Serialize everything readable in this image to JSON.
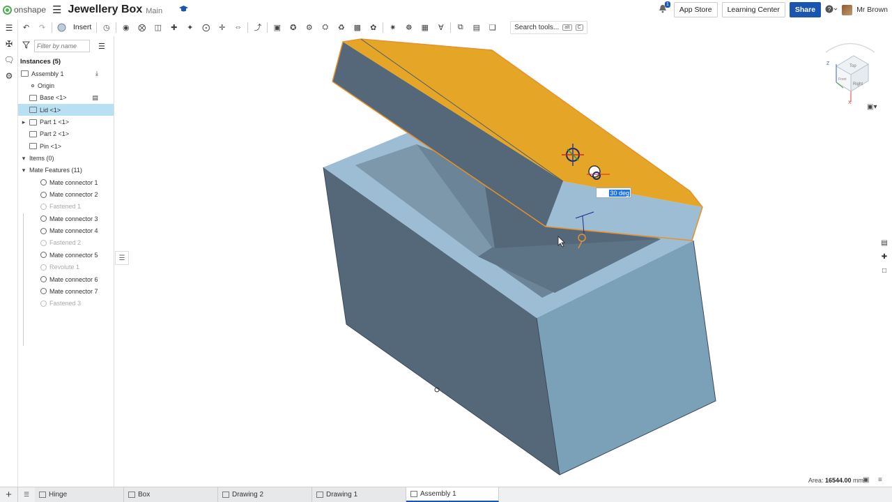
{
  "app": {
    "logo_text": "onshape",
    "doc_title": "Jewellery Box",
    "branch": "Main"
  },
  "topbar": {
    "notification_count": "1",
    "app_store": "App Store",
    "learning_center": "Learning Center",
    "share": "Share",
    "help": "?",
    "user_name": "Mr Brown"
  },
  "toolbar": {
    "insert_label": "Insert",
    "search_label": "Search tools...",
    "search_shortcut_1": "alt",
    "search_shortcut_2": "C"
  },
  "panel": {
    "filter_placeholder": "Filter by name",
    "instances_header": "Instances (5)",
    "tree": [
      {
        "label": "Assembly 1",
        "kind": "assembly"
      },
      {
        "label": "Origin",
        "kind": "origin"
      },
      {
        "label": "Base <1>",
        "kind": "part"
      },
      {
        "label": "Lid <1>",
        "kind": "part",
        "selected": true
      },
      {
        "label": "Part 1 <1>",
        "kind": "part"
      },
      {
        "label": "Part 2 <1>",
        "kind": "part"
      },
      {
        "label": "Pin <1>",
        "kind": "part"
      },
      {
        "label": "Items (0)",
        "kind": "folder"
      },
      {
        "label": "Mate Features (11)",
        "kind": "folder"
      },
      {
        "label": "Mate connector 1",
        "kind": "mate"
      },
      {
        "label": "Mate connector 2",
        "kind": "mate"
      },
      {
        "label": "Fastened 1",
        "kind": "fastened"
      },
      {
        "label": "Mate connector 3",
        "kind": "mate"
      },
      {
        "label": "Mate connector 4",
        "kind": "mate"
      },
      {
        "label": "Fastened 2",
        "kind": "fastened"
      },
      {
        "label": "Mate connector 5",
        "kind": "mate"
      },
      {
        "label": "Revolute 1",
        "kind": "revolute"
      },
      {
        "label": "Mate connector 6",
        "kind": "mate"
      },
      {
        "label": "Mate connector 7",
        "kind": "mate"
      },
      {
        "label": "Fastened 3",
        "kind": "fastened"
      }
    ]
  },
  "viewport": {
    "angle_value": "30 deg",
    "area_label": "Area:",
    "area_value": "16544.00",
    "area_unit": "mm²",
    "view_cube": {
      "top": "Top",
      "front": "Front",
      "right": "Right",
      "axis_z": "Z",
      "axis_x": "X"
    },
    "colors": {
      "box_face": "#7ba1b9",
      "box_dark": "#56687a",
      "lid_top": "#e5a628",
      "lid_edge": "#a7c8df"
    }
  },
  "tabs": [
    {
      "label": "Hinge",
      "active": false
    },
    {
      "label": "Box",
      "active": false
    },
    {
      "label": "Drawing 2",
      "active": false
    },
    {
      "label": "Drawing 1",
      "active": false
    },
    {
      "label": "Assembly 1",
      "active": true
    }
  ]
}
